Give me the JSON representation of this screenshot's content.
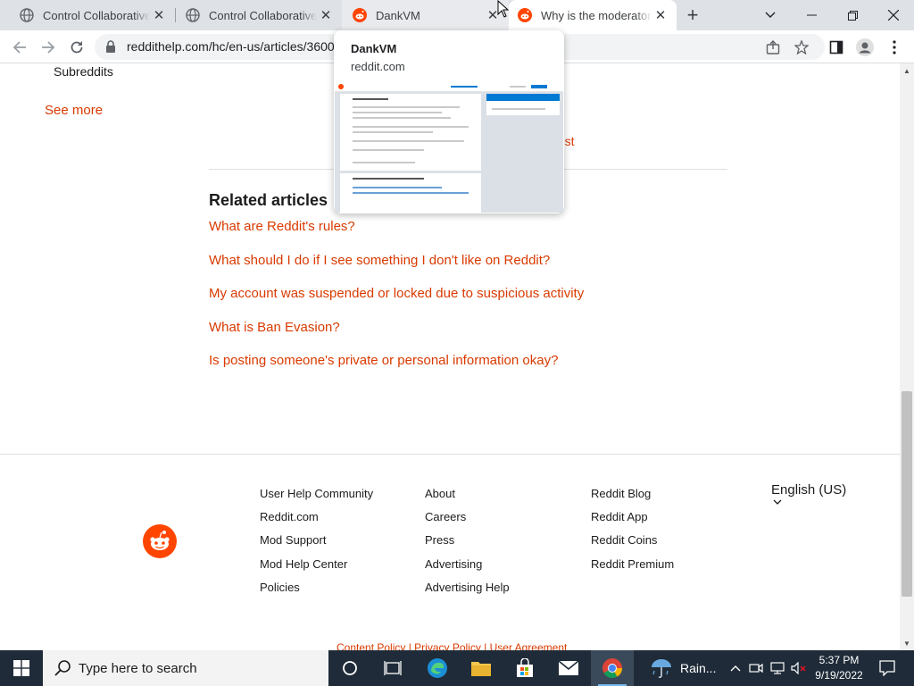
{
  "browser": {
    "tabs": [
      {
        "title": "Control Collaborative W",
        "icon": "globe-icon"
      },
      {
        "title": "Control Collaborative W",
        "icon": "globe-icon"
      },
      {
        "title": "DankVM",
        "icon": "reddit-icon"
      },
      {
        "title": "Why is the moderator t",
        "icon": "reddit-icon"
      }
    ],
    "url": "reddithelp.com/hc/en-us/articles/3600"
  },
  "hovercard": {
    "title": "DankVM",
    "domain": "reddit.com"
  },
  "page": {
    "sidebar_item": "Subreddits",
    "see_more": "See more",
    "request_fragment": "uest",
    "related_heading": "Related articles",
    "related_articles": [
      "What are Reddit's rules?",
      "What should I do if I see something I don't like on Reddit?",
      "My account was suspended or locked due to suspicious activity",
      "What is Ban Evasion?",
      "Is posting someone's private or personal information okay?"
    ]
  },
  "footer": {
    "col1": [
      "User Help Community",
      "Reddit.com",
      "Mod Support",
      "Mod Help Center",
      "Policies"
    ],
    "col2": [
      "About",
      "Careers",
      "Press",
      "Advertising",
      "Advertising Help"
    ],
    "col3": [
      "Reddit Blog",
      "Reddit App",
      "Reddit Coins",
      "Reddit Premium"
    ],
    "language": "English (US)",
    "legal": "Content Policy | Privacy Policy | User Agreement"
  },
  "taskbar": {
    "search_placeholder": "Type here to search",
    "weather": "Rain...",
    "time": "5:37 PM",
    "date": "9/19/2022"
  },
  "colors": {
    "reddit_orange": "#ff4500",
    "link_orange": "#d93a00",
    "taskbar": "#1f2b38"
  }
}
